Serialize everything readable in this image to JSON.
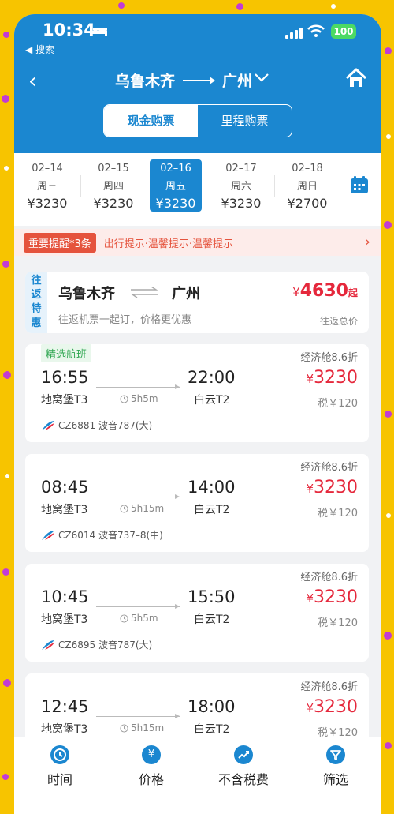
{
  "status": {
    "time": "10:34",
    "back_app": "◀ 搜索",
    "battery": "100"
  },
  "nav": {
    "from": "乌鲁木齐",
    "to": "广州"
  },
  "segment": {
    "cash": "现金购票",
    "miles": "里程购票"
  },
  "dates": [
    {
      "date": "02–14",
      "weekday": "周三",
      "price": "¥3230",
      "selected": false
    },
    {
      "date": "02–15",
      "weekday": "周四",
      "price": "¥3230",
      "selected": false
    },
    {
      "date": "02–16",
      "weekday": "周五",
      "price": "¥3230",
      "selected": true
    },
    {
      "date": "02–17",
      "weekday": "周六",
      "price": "¥3230",
      "selected": false
    },
    {
      "date": "02–18",
      "weekday": "周日",
      "price": "¥2700",
      "selected": false
    }
  ],
  "notice": {
    "tag": "重要提醒*3条",
    "text": "出行提示·温馨提示·温馨提示"
  },
  "round_trip": {
    "badge": "往返特惠",
    "from": "乌鲁木齐",
    "to": "广州",
    "subtitle": "往返机票一起订，价格更优惠",
    "currency": "¥",
    "price": "4630",
    "price_suffix": "起",
    "total_label": "往返总价"
  },
  "selected_label": "精选航班",
  "flights": [
    {
      "dep_time": "16:55",
      "dep_airport": "地窝堡T3",
      "arr_time": "22:00",
      "arr_airport": "白云T2",
      "duration": "5h5m",
      "flight_info": "CZ6881 波音787(大)",
      "cabin": "经济舱8.6折",
      "currency": "¥",
      "price": "3230",
      "tax": "税￥120"
    },
    {
      "dep_time": "08:45",
      "dep_airport": "地窝堡T3",
      "arr_time": "14:00",
      "arr_airport": "白云T2",
      "duration": "5h15m",
      "flight_info": "CZ6014 波音737–8(中)",
      "cabin": "经济舱8.6折",
      "currency": "¥",
      "price": "3230",
      "tax": "税￥120"
    },
    {
      "dep_time": "10:45",
      "dep_airport": "地窝堡T3",
      "arr_time": "15:50",
      "arr_airport": "白云T2",
      "duration": "5h5m",
      "flight_info": "CZ6895 波音787(大)",
      "cabin": "经济舱8.6折",
      "currency": "¥",
      "price": "3230",
      "tax": "税￥120"
    },
    {
      "dep_time": "12:45",
      "dep_airport": "地窝堡T3",
      "arr_time": "18:00",
      "arr_airport": "白云T2",
      "duration": "5h15m",
      "flight_info": "",
      "cabin": "经济舱8.6折",
      "currency": "¥",
      "price": "3230",
      "tax": "税￥120"
    }
  ],
  "tabs": [
    {
      "label": "时间",
      "icon": "clock-icon"
    },
    {
      "label": "价格",
      "icon": "yuan-icon"
    },
    {
      "label": "不含税费",
      "icon": "trend-icon"
    },
    {
      "label": "筛选",
      "icon": "filter-icon"
    }
  ],
  "colors": {
    "brand": "#1b87d0",
    "price": "#e5283c",
    "notice": "#e5533d",
    "frame": "#f7c400"
  }
}
